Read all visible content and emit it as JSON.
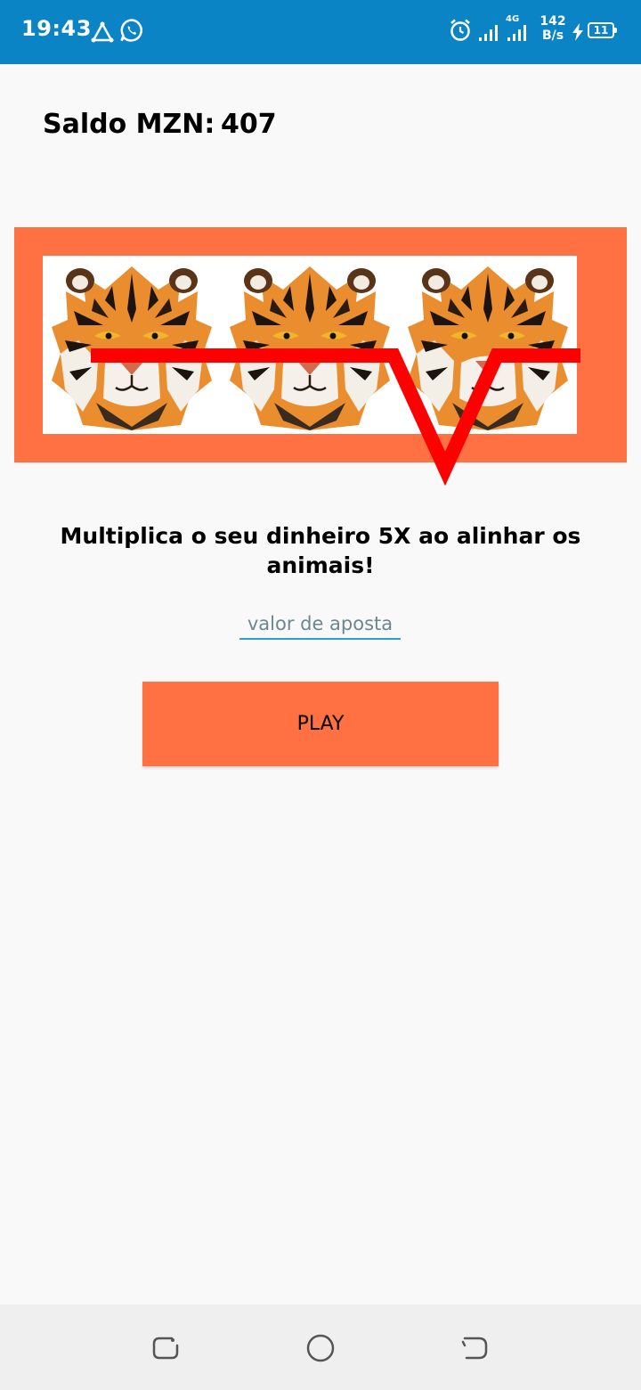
{
  "status_bar": {
    "time": "19:43",
    "network_type": "4G",
    "net_speed_value": "142",
    "net_speed_unit": "B/s",
    "battery_level": "11",
    "background_color": "#0a84c4",
    "left_icons": [
      "navigation-arrow-icon",
      "whatsapp-icon"
    ],
    "right_icons": [
      "alarm-icon",
      "signal-icon",
      "signal-4g-icon",
      "charging-icon",
      "battery-icon"
    ]
  },
  "balance": {
    "label": "Saldo MZN:",
    "value": "407"
  },
  "slot_machine": {
    "panel_color": "#ff7043",
    "reels": [
      "tiger",
      "tiger",
      "tiger"
    ],
    "payline_color": "#ff0000"
  },
  "message": "Multiplica o seu dinheiro 5X ao alinhar os animais!",
  "bet_input": {
    "placeholder": "valor de aposta",
    "value": ""
  },
  "play_button": {
    "label": "PLAY",
    "color": "#ff7043"
  },
  "nav_bar": {
    "buttons": [
      "recents-icon",
      "home-icon",
      "back-icon"
    ]
  }
}
